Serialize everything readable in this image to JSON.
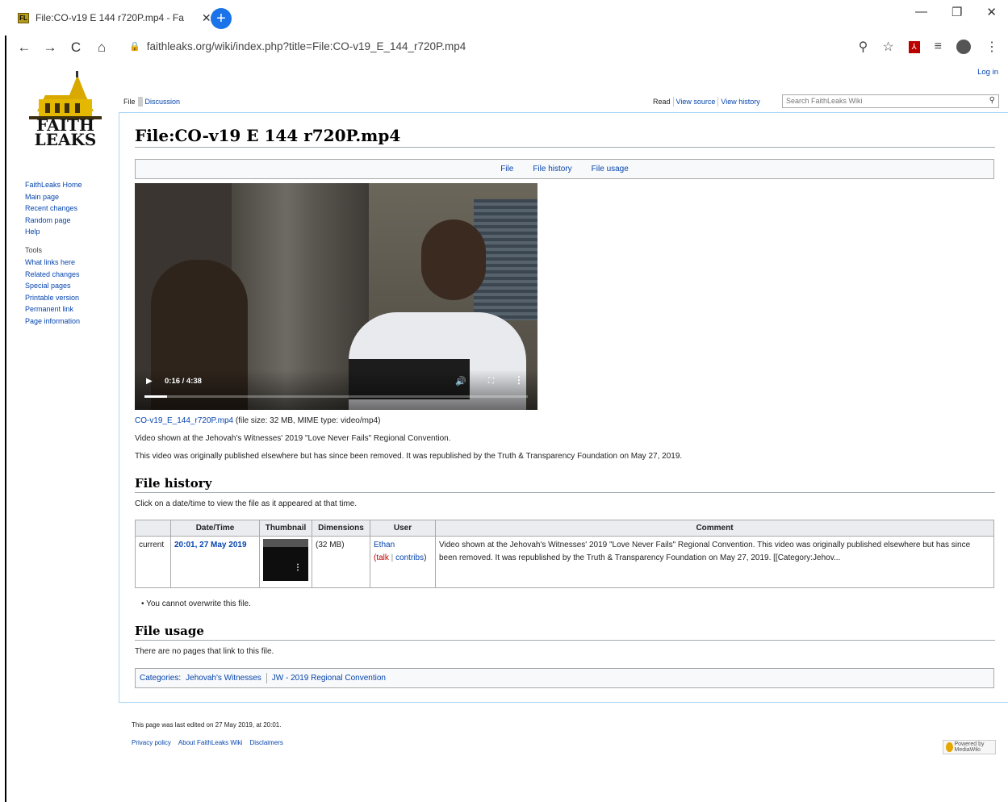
{
  "browser": {
    "tab_favicon": "FL",
    "tab_title": "File:CO-v19 E 144 r720P.mp4 - Fa",
    "tab_close": "✕",
    "new_tab": "+",
    "minimize": "—",
    "restore": "❐",
    "close": "✕",
    "back": "←",
    "forward": "→",
    "reload": "C",
    "home": "⌂",
    "lock": "🔒",
    "url": "faithleaks.org/wiki/index.php?title=File:CO-v19_E_144_r720P.mp4",
    "zoom_icon": "⚲",
    "star_icon": "☆",
    "pdf_icon": "⅄",
    "reading_list_icon": "≡",
    "menu_icon": "⋮"
  },
  "wiki": {
    "login": "Log in",
    "logo_line1": "FAITH",
    "logo_line2": "LEAKS",
    "nav": [
      "FaithLeaks Home",
      "Main page",
      "Recent changes",
      "Random page",
      "Help"
    ],
    "tools_header": "Tools",
    "tools": [
      "What links here",
      "Related changes",
      "Special pages",
      "Printable version",
      "Permanent link",
      "Page information"
    ],
    "tab_file": "File",
    "tab_discussion": "Discussion",
    "tab_read": "Read",
    "tab_view_source": "View source",
    "tab_view_history": "View history",
    "search_placeholder": "Search FaithLeaks Wiki",
    "search_icon": "⚲",
    "title": "File:CO-v19 E 144 r720P.mp4",
    "filetoc": [
      "File",
      "File history",
      "File usage"
    ],
    "video": {
      "play": "▶",
      "time": "0:16 / 4:38",
      "volume": "🔊",
      "fullscreen": "⛶",
      "more": "⋮",
      "progress": 0.058
    },
    "file_link": "CO-v19_E_144_r720P.mp4",
    "file_meta": " (file size: 32 MB, MIME type: video/mp4)",
    "description1": "Video shown at the Jehovah's Witnesses' 2019 \"Love Never Fails\" Regional Convention.",
    "description2": "This video was originally published elsewhere but has since been removed. It was republished by the Truth & Transparency Foundation on May 27, 2019.",
    "history_heading": "File history",
    "history_intro": "Click on a date/time to view the file as it appeared at that time.",
    "history_table": {
      "headers": [
        "",
        "Date/Time",
        "Thumbnail",
        "Dimensions",
        "User",
        "Comment"
      ],
      "row": {
        "status": "current",
        "datetime": "20:01, 27 May 2019",
        "thumb_dots": "⋮",
        "dimensions": "(32 MB)",
        "user": "Ethan",
        "user_talk_open": "(",
        "user_talk": "talk",
        "user_sep": " | ",
        "user_contribs": "contribs",
        "user_talk_close": ")",
        "comment": "Video shown at the Jehovah's Witnesses' 2019 \"Love Never Fails\" Regional Convention. This video was originally published elsewhere but has since been removed. It was republished by the Truth & Transparency Foundation on May 27, 2019. [[Category:Jehov..."
      }
    },
    "overwrite_note": "You cannot overwrite this file.",
    "usage_heading": "File usage",
    "usage_text": "There are no pages that link to this file.",
    "categories_label": "Categories",
    "categories_colon": ":",
    "categories": [
      "Jehovah's Witnesses",
      "JW - 2019 Regional Convention"
    ],
    "footer_edited": "This page was last edited on 27 May 2019, at 20:01.",
    "footer_links": [
      "Privacy policy",
      "About FaithLeaks Wiki",
      "Disclaimers"
    ],
    "powered_by": "Powered by MediaWiki"
  }
}
